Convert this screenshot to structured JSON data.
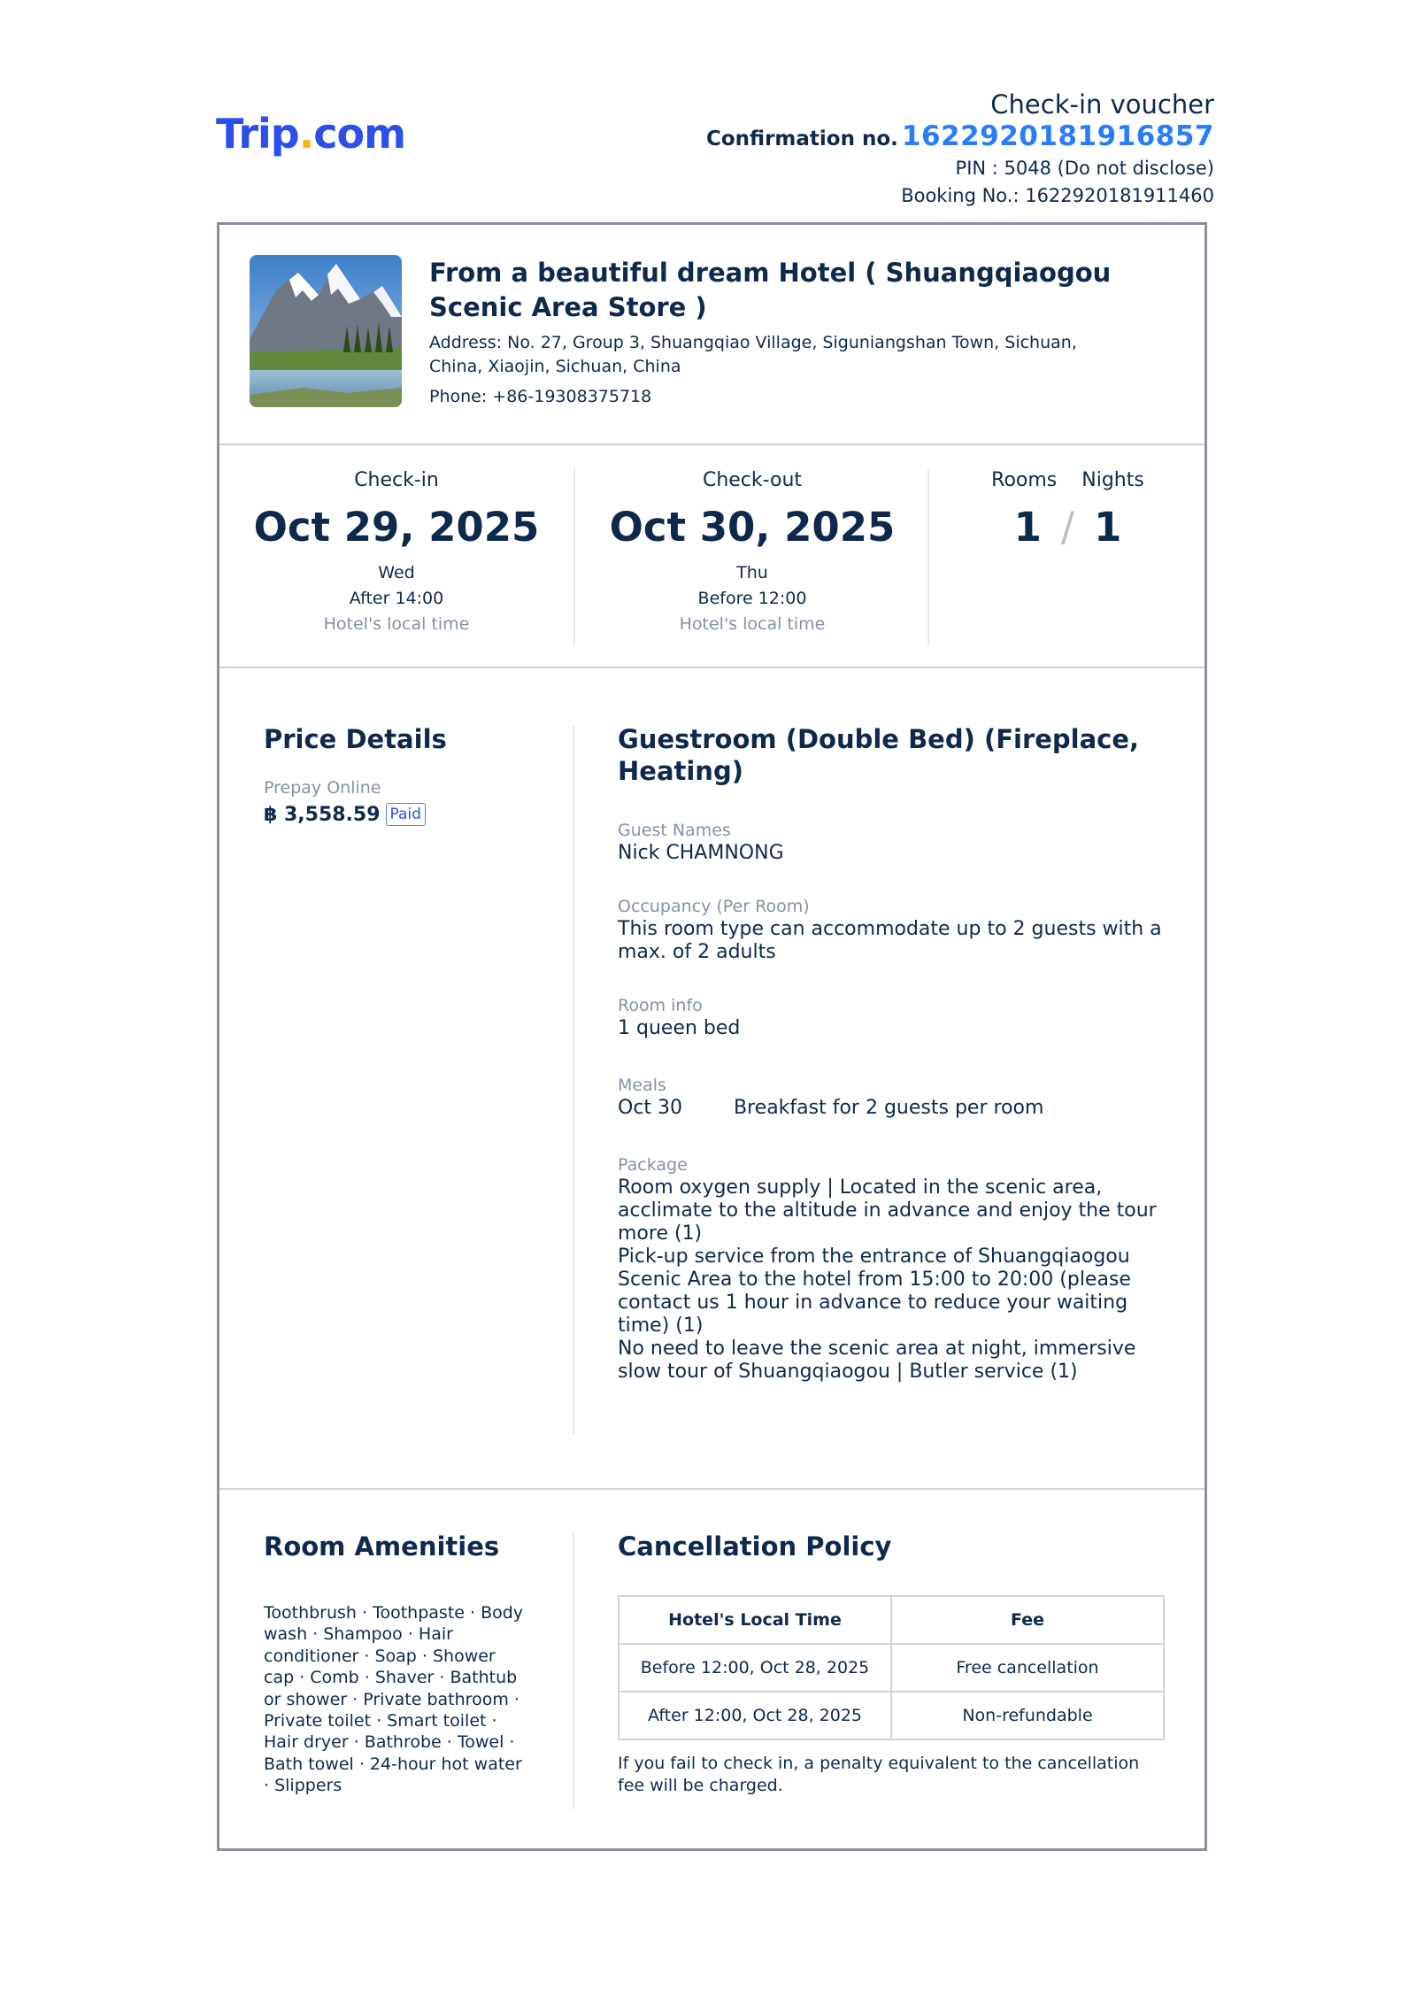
{
  "header": {
    "logo_main": "Trip",
    "logo_dot": ".",
    "logo_tail": "com",
    "title": "Check-in voucher",
    "confirmation_label": "Confirmation no.",
    "confirmation_number": "1622920181916857",
    "pin": "PIN : 5048 (Do not disclose)",
    "booking": "Booking No.: 1622920181911460"
  },
  "hotel": {
    "name": "From a beautiful dream Hotel ( Shuangqiaogou Scenic Area Store )",
    "address": "Address: No. 27, Group 3, Shuangqiao Village, Siguniangshan Town, Sichuan, China, Xiaojin, Sichuan, China",
    "phone": "Phone: +86-19308375718"
  },
  "stay": {
    "checkin": {
      "label": "Check-in",
      "date": "Oct 29, 2025",
      "weekday": "Wed",
      "time": "After 14:00",
      "note": "Hotel's local time"
    },
    "checkout": {
      "label": "Check-out",
      "date": "Oct 30, 2025",
      "weekday": "Thu",
      "time": "Before 12:00",
      "note": "Hotel's local time"
    },
    "rooms_label": "Rooms",
    "nights_label": "Nights",
    "rooms": "1",
    "nights": "1",
    "separator": "/"
  },
  "price": {
    "title": "Price Details",
    "method": "Prepay Online",
    "amount": "฿ 3,558.59",
    "status": "Paid"
  },
  "room": {
    "title": "Guestroom (Double Bed) (Fireplace, Heating)",
    "guest_label": "Guest Names",
    "guest": "Nick CHAMNONG",
    "occupancy_label": "Occupancy (Per Room)",
    "occupancy": "This room type can accommodate up to 2 guests with a max. of 2 adults",
    "info_label": "Room info",
    "info": "1 queen bed",
    "meals_label": "Meals",
    "meal_date": "Oct 30",
    "meal_desc": "Breakfast for 2 guests per room",
    "package_label": "Package",
    "packages": [
      "Room oxygen supply | Located in the scenic area, acclimate to the altitude in advance and enjoy the tour more (1)",
      "Pick-up service from the entrance of Shuangqiaogou Scenic Area to the hotel from 15:00 to 20:00 (please contact us 1 hour in advance to reduce your waiting time) (1)",
      "No need to leave the scenic area at night, immersive slow tour of Shuangqiaogou | Butler service (1)"
    ]
  },
  "amenities": {
    "title": "Room Amenities",
    "text": "Toothbrush · Toothpaste · Body wash · Shampoo · Hair conditioner · Soap · Shower cap · Comb · Shaver · Bathtub or shower · Private bathroom · Private toilet · Smart toilet · Hair dryer · Bathrobe · Towel · Bath towel · 24-hour hot water · Slippers"
  },
  "cancellation": {
    "title": "Cancellation Policy",
    "headers": [
      "Hotel's Local Time",
      "Fee"
    ],
    "rows": [
      [
        "Before 12:00, Oct 28, 2025",
        "Free cancellation"
      ],
      [
        "After 12:00, Oct 28, 2025",
        "Non-refundable"
      ]
    ],
    "note": "If you fail to check in, a penalty equivalent to the cancellation fee will be charged."
  },
  "colors": {
    "brand": "#2b4fe8",
    "accent_dot": "#ffb300",
    "confirmation": "#287dfa",
    "text": "#0f294d",
    "muted": "#8592a6"
  }
}
